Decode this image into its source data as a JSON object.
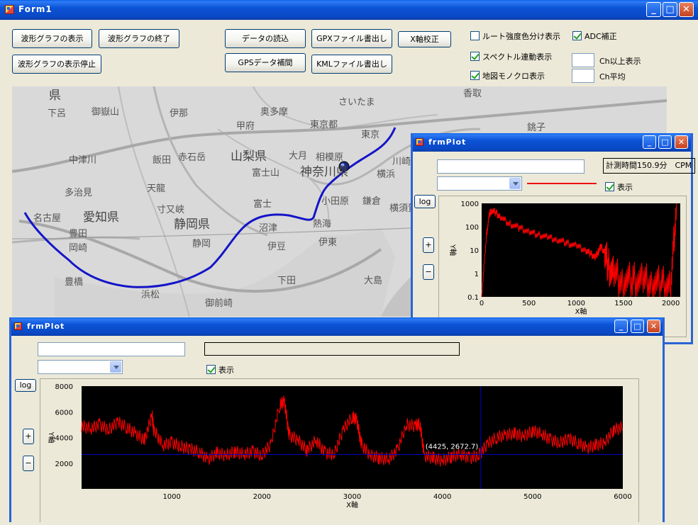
{
  "main_window": {
    "title": "Form1",
    "buttons": {
      "show_wave": "波形グラフの表示",
      "end_wave": "波形グラフの終了",
      "pause_wave": "波形グラフの表示停止",
      "load_data": "データの読込",
      "gps_interp": "GPSデータ補間",
      "gpx_export": "GPXファイル書出し",
      "kml_export": "KMLファイル書出し",
      "x_calib": "X軸校正"
    },
    "checkboxes": {
      "route_color": {
        "label": "ルート強度色分け表示",
        "checked": false
      },
      "adc_correct": {
        "label": "ADC補正",
        "checked": true
      },
      "spectrum_link": {
        "label": "スペクトル連動表示",
        "checked": true
      },
      "map_mono": {
        "label": "地図モノクロ表示",
        "checked": true
      }
    },
    "fields": {
      "ch_min_value": "",
      "ch_min_label": "Ch以上表示",
      "ch_avg_value": "",
      "ch_avg_label": "Ch平均"
    }
  },
  "map": {
    "labels": [
      "県",
      "下呂",
      "御嶽山",
      "伊那",
      "奥多摩",
      "さいたま",
      "香取",
      "甲府",
      "東京都",
      "東京",
      "銚子",
      "中津川",
      "飯田",
      "赤石岳",
      "山梨県",
      "大月",
      "相模原",
      "川崎",
      "富士山",
      "神奈川県",
      "横浜",
      "多治見",
      "天龍",
      "寸又峡",
      "名古屋",
      "愛知県",
      "静岡県",
      "富士",
      "小田原",
      "鎌倉",
      "横須賀",
      "豊田",
      "岡崎",
      "沼津",
      "熱海",
      "静岡",
      "伊豆",
      "伊東",
      "豊橋",
      "浜松",
      "下田",
      "大島",
      "御前崎"
    ]
  },
  "spectrum_window": {
    "title": "frmPlot",
    "text_field": "",
    "measure_time": "計測時間150.9分　CPM",
    "show_label": "表示",
    "show_checked": true,
    "log_button": "log",
    "plus_button": "+",
    "minus_button": "−",
    "colors": {
      "line": "#ff0000",
      "background": "#000000"
    },
    "chart_data": {
      "type": "line",
      "xlabel": "X軸",
      "ylabel": "Y軸",
      "xlim": [
        0,
        2100
      ],
      "ylim": [
        0.1,
        1000
      ],
      "log_y": true,
      "x_ticks": [
        0,
        500,
        1000,
        1500,
        2000
      ],
      "y_ticks": [
        "0.1",
        "1",
        "10",
        "100",
        "1000"
      ],
      "series": [
        {
          "x": [
            0,
            50,
            80,
            100,
            150,
            200,
            300,
            400,
            500,
            600,
            700,
            800,
            900,
            1000,
            1100,
            1150,
            1200,
            1230,
            1260,
            1300,
            1340,
            1400,
            1500,
            1600,
            1700,
            1800,
            1900,
            2000,
            2060
          ],
          "y": [
            0.1,
            40,
            300,
            500,
            400,
            250,
            130,
            90,
            60,
            45,
            35,
            28,
            20,
            15,
            10,
            7,
            5,
            8,
            14,
            8,
            2,
            0.8,
            0.5,
            0.5,
            0.45,
            0.4,
            0.35,
            0.3,
            1000
          ]
        }
      ]
    }
  },
  "wave_window": {
    "title": "frmPlot",
    "text_field": "",
    "status_field": "",
    "show_label": "表示",
    "show_checked": true,
    "log_button": "log",
    "plus_button": "+",
    "minus_button": "−",
    "cursor_label": "(4425, 2672.7)",
    "colors": {
      "line": "#ff0000",
      "background": "#000000",
      "cursor": "#0000c8"
    },
    "chart_data": {
      "type": "line",
      "xlabel": "X軸",
      "ylabel": "Y軸",
      "xlim": [
        0,
        6000
      ],
      "ylim": [
        0,
        8000
      ],
      "x_ticks": [
        1000,
        2000,
        3000,
        4000,
        5000,
        6000
      ],
      "y_ticks": [
        2000,
        4000,
        6000,
        8000
      ],
      "cursor": {
        "x": 4425,
        "y": 2672.7
      },
      "series": [
        {
          "x": [
            0,
            100,
            200,
            300,
            400,
            500,
            600,
            700,
            780,
            800,
            900,
            1000,
            1100,
            1200,
            1300,
            1400,
            1500,
            1600,
            1700,
            1800,
            1900,
            2000,
            2100,
            2200,
            2250,
            2300,
            2400,
            2500,
            2600,
            2700,
            2800,
            2900,
            3000,
            3050,
            3100,
            3200,
            3300,
            3400,
            3500,
            3600,
            3700,
            3750,
            3800,
            3900,
            4000,
            4100,
            4200,
            4300,
            4400,
            4500,
            4600,
            4700,
            4800,
            4900,
            5000,
            5100,
            5200,
            5300,
            5400,
            5500,
            5600,
            5700,
            5800,
            5900,
            6000
          ],
          "y": [
            4900,
            4700,
            5000,
            4600,
            5200,
            4800,
            4300,
            3800,
            5800,
            4600,
            3400,
            3600,
            3300,
            3100,
            2900,
            2300,
            2800,
            2600,
            2900,
            2700,
            2900,
            2600,
            3500,
            6600,
            6800,
            4200,
            3800,
            3000,
            3800,
            2800,
            2700,
            4600,
            5600,
            5400,
            3500,
            2600,
            2400,
            2300,
            3000,
            5000,
            4900,
            5100,
            2600,
            2400,
            2200,
            2500,
            2700,
            2400,
            2600,
            3500,
            4000,
            4200,
            4300,
            4100,
            4500,
            4300,
            3800,
            3600,
            3900,
            3600,
            3200,
            3400,
            3600,
            4600,
            4800
          ]
        }
      ]
    }
  }
}
